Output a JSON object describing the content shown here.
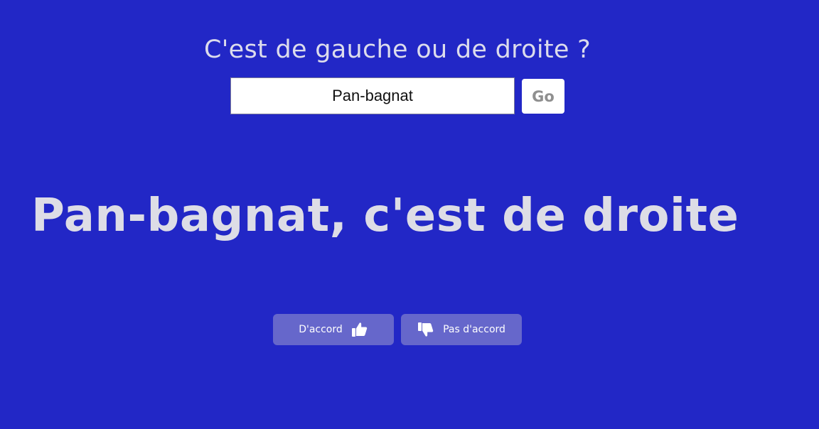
{
  "header": {
    "question": "C'est de gauche ou de droite ?"
  },
  "search": {
    "value": "Pan-bagnat",
    "go_label": "Go"
  },
  "result": {
    "verdict": "Pan-bagnat, c'est de droite"
  },
  "vote": {
    "agree_label": "D'accord",
    "agree_icon": "thumbs-up-icon",
    "disagree_label": "Pas d'accord",
    "disagree_icon": "thumbs-down-icon"
  },
  "colors": {
    "background": "#2227c6",
    "text_light": "#dcdcec",
    "button_bg": "#6667cb",
    "go_text": "#8f8f8f"
  }
}
